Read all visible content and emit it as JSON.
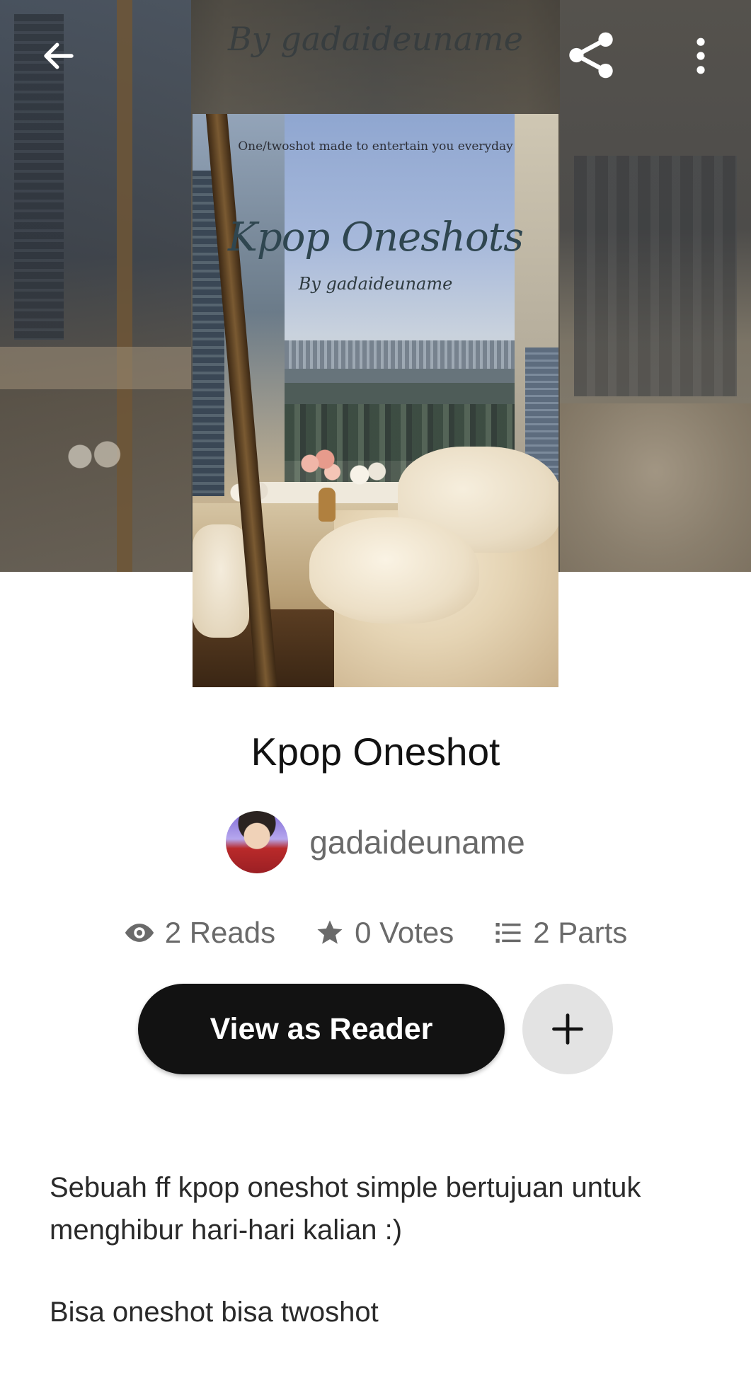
{
  "header": {
    "background_title": "By gadaideuname"
  },
  "toolbar": {
    "back_icon": "arrow-left-icon",
    "share_icon": "share-icon",
    "more_icon": "more-vertical-icon"
  },
  "cover": {
    "tagline": "One/twoshot made to entertain you everyday",
    "title": "Kpop Oneshots",
    "byline": "By gadaideuname"
  },
  "story": {
    "title": "Kpop Oneshot",
    "author": "gadaideuname"
  },
  "stats": {
    "reads": "2 Reads",
    "votes": "0 Votes",
    "parts": "2 Parts"
  },
  "actions": {
    "reader_label": "View as Reader",
    "add_icon": "plus-icon"
  },
  "description": {
    "paragraph1": "Sebuah ff kpop oneshot simple bertujuan untuk menghibur hari-hari kalian :)",
    "paragraph2": "Bisa oneshot bisa twoshot"
  },
  "colors": {
    "primary_button": "#121212",
    "secondary_button": "#e3e3e3",
    "text_primary": "#121212",
    "text_secondary": "#6a6a6a"
  }
}
